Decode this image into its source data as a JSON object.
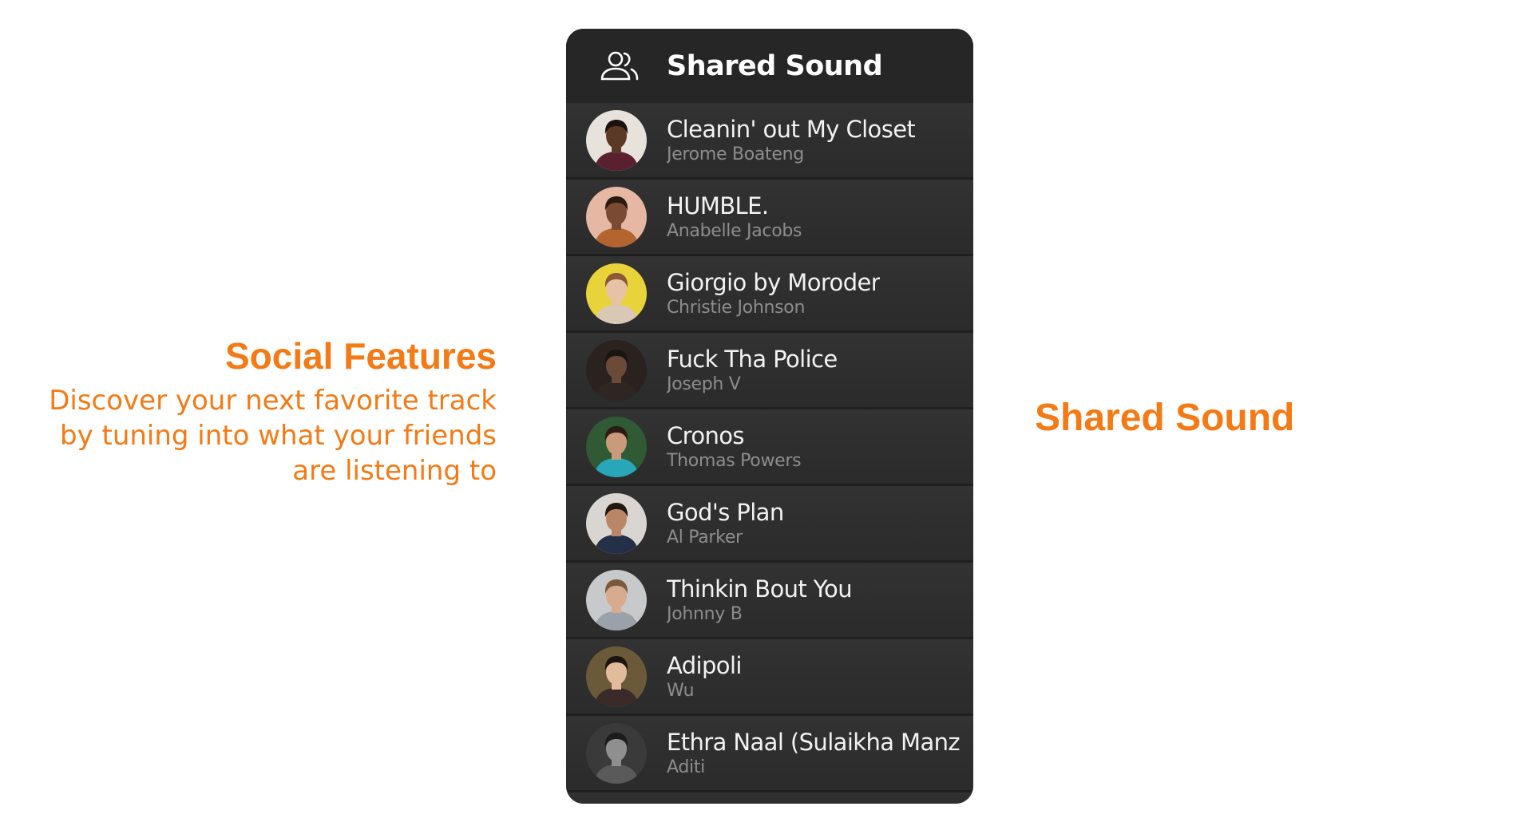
{
  "promo": {
    "title": "Social Features",
    "description_line1": "Discover your next favorite track",
    "description_line2": "by tuning into what your friends",
    "description_line3": "are listening to"
  },
  "caption": "Shared Sound",
  "panel": {
    "title": "Shared Sound",
    "icon": "people-icon"
  },
  "items": [
    {
      "track": "Cleanin' out My Closet",
      "user": "Jerome Boateng",
      "avatar_bg": "#e8e2dc",
      "skin": "#5a3a26",
      "hair": "#1a120e",
      "shirt": "#5b2030"
    },
    {
      "track": "HUMBLE.",
      "user": "Anabelle Jacobs",
      "avatar_bg": "#e6b7a3",
      "skin": "#7a4a32",
      "hair": "#2a1a12",
      "shirt": "#b4642e"
    },
    {
      "track": "Giorgio by Moroder",
      "user": "Christie Johnson",
      "avatar_bg": "#e9d33a",
      "skin": "#e7c2a4",
      "hair": "#8a5a35",
      "shirt": "#d9c8b6"
    },
    {
      "track": "Fuck Tha Police",
      "user": "Joseph V",
      "avatar_bg": "#2a221e",
      "skin": "#6b4a3a",
      "hair": "#1a1412",
      "shirt": "#2d2622"
    },
    {
      "track": "Cronos",
      "user": "Thomas Powers",
      "avatar_bg": "#2f5a33",
      "skin": "#c99a7c",
      "hair": "#2a1c14",
      "shirt": "#27a7b7"
    },
    {
      "track": "God's Plan",
      "user": "Al Parker",
      "avatar_bg": "#d9d6d2",
      "skin": "#b98668",
      "hair": "#22180f",
      "shirt": "#243047"
    },
    {
      "track": "Thinkin Bout You",
      "user": "Johnny B",
      "avatar_bg": "#c7c9cb",
      "skin": "#d8ab8f",
      "hair": "#7a5a3e",
      "shirt": "#9aa1a8"
    },
    {
      "track": "Adipoli",
      "user": "Wu",
      "avatar_bg": "#6b5a3a",
      "skin": "#e2bb9c",
      "hair": "#1c1410",
      "shirt": "#3a2a2a"
    },
    {
      "track": "Ethra Naal (Sulaikha Manz",
      "user": "Aditi",
      "avatar_bg": "#3a3a3a",
      "skin": "#8f8f8f",
      "hair": "#1c1c1c",
      "shirt": "#5a5a5a"
    }
  ],
  "colors": {
    "accent": "#f37a14",
    "panel_bg": "#1f1f1f",
    "row_bg": "#2f2f2f",
    "track_text": "#f2f2f2",
    "artist_text": "#8d8d8d"
  }
}
